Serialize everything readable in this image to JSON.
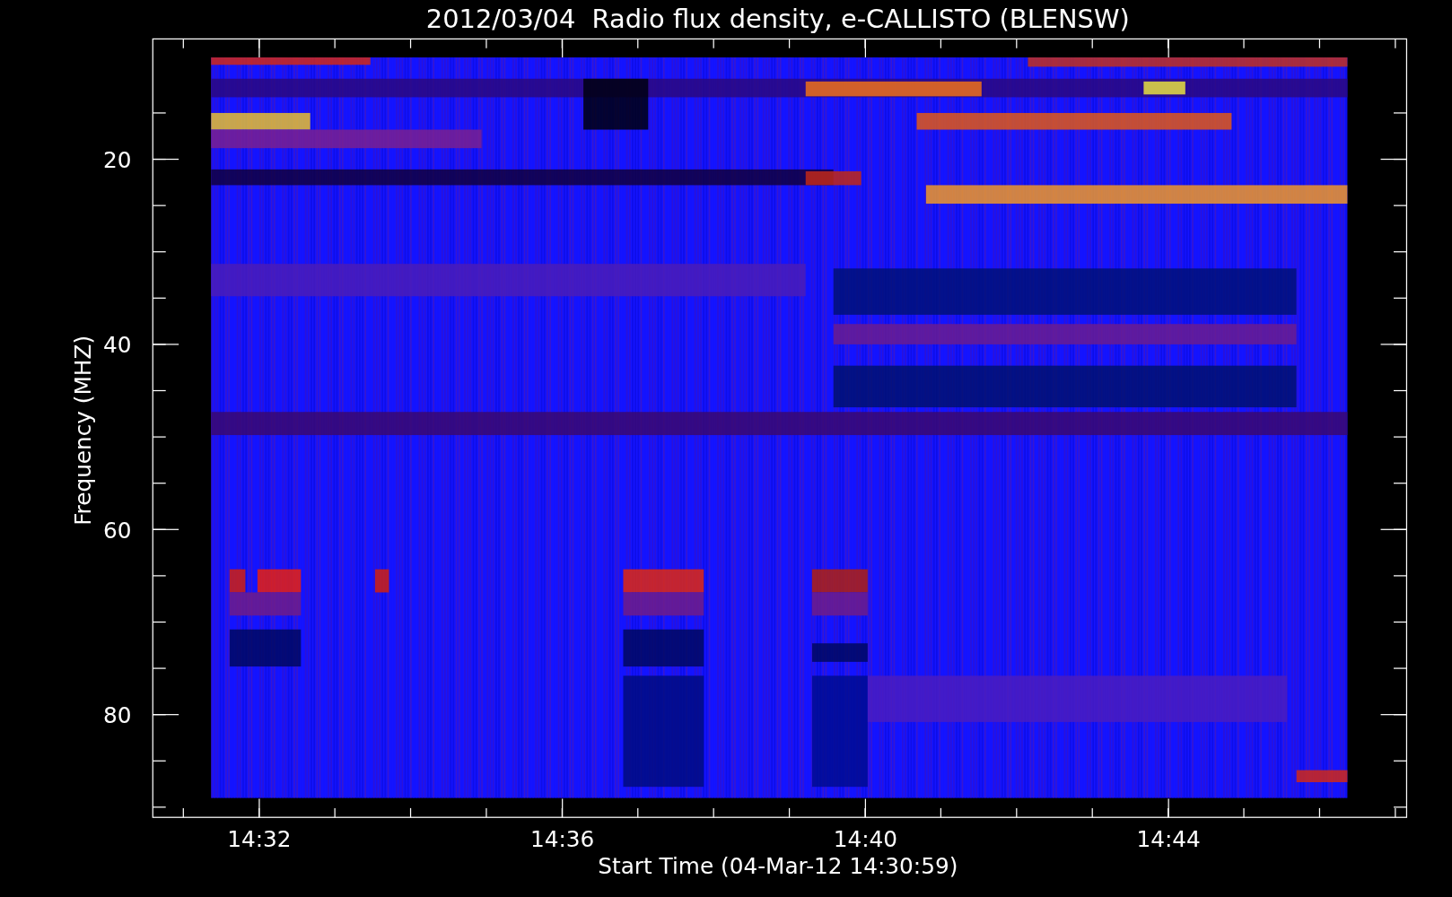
{
  "plot": {
    "title": "2012/03/04  Radio flux density, e-CALLISTO (BLENSW)",
    "ylabel": "Frequency (MHZ)",
    "xlabel": "Start Time (04-Mar-12 14:30:59)",
    "yticks": [
      "20",
      "40",
      "60",
      "80"
    ],
    "xticks": [
      "14:32",
      "14:36",
      "14:40",
      "14:44"
    ]
  }
}
